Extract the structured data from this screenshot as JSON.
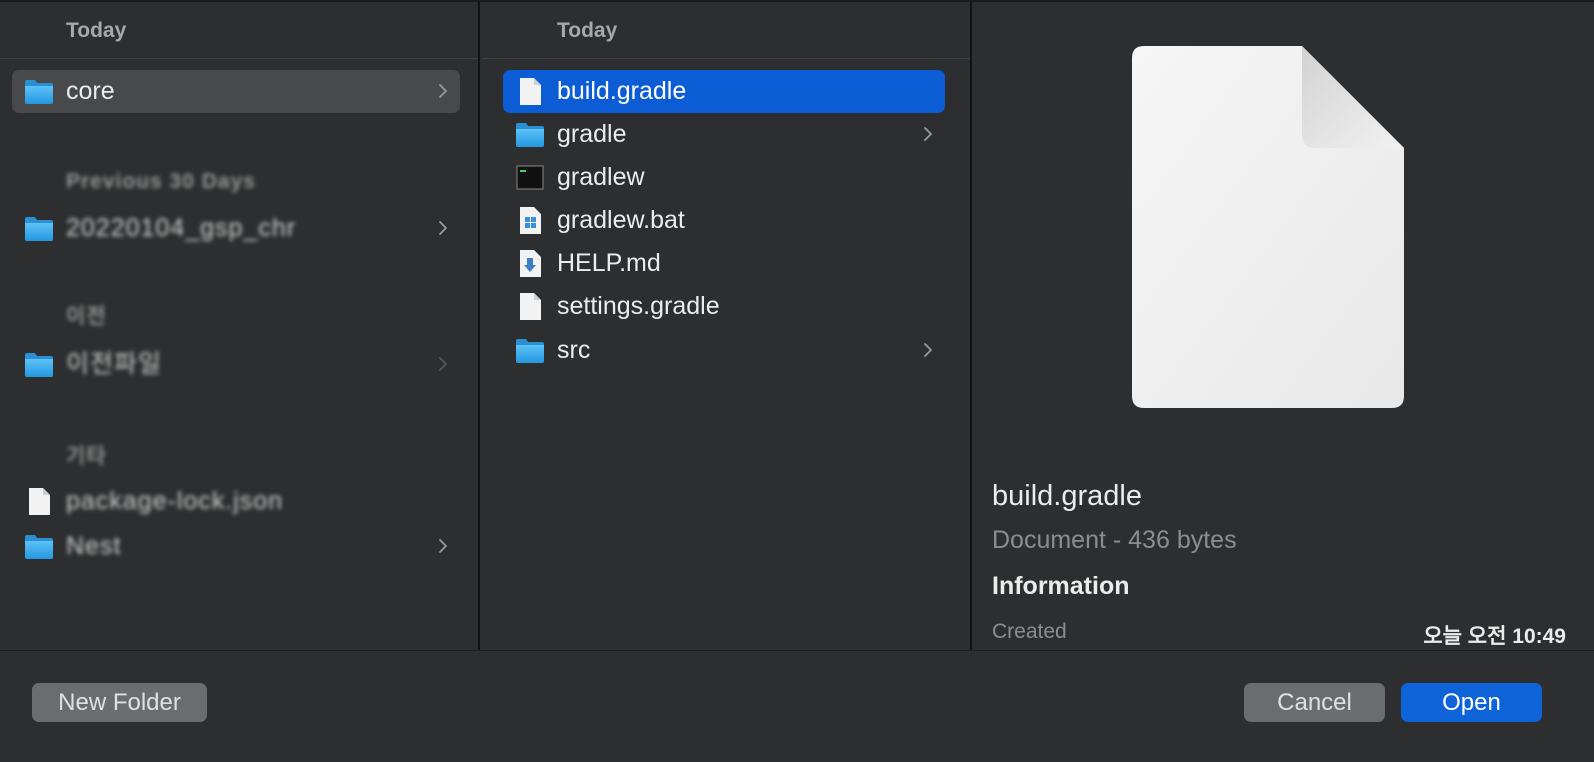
{
  "columns": {
    "left": {
      "sections": [
        {
          "header": "Today",
          "items": [
            {
              "label": "core",
              "icon": "folder-icon",
              "has_children": true,
              "selected": true
            }
          ]
        },
        {
          "header": "Previous 30 Days",
          "items": [
            {
              "label": "20220104_gsp_chr",
              "icon": "folder-icon",
              "has_children": true
            }
          ]
        },
        {
          "header": "이전",
          "items": [
            {
              "label": "이전파일",
              "icon": "folder-icon",
              "has_children": true
            }
          ]
        },
        {
          "header": "기타",
          "items": [
            {
              "label": "package-lock.json",
              "icon": "document-icon",
              "has_children": false
            },
            {
              "label": "Nest",
              "icon": "folder-icon",
              "has_children": true
            }
          ]
        }
      ]
    },
    "middle": {
      "header": "Today",
      "items": [
        {
          "label": "build.gradle",
          "icon": "document-icon",
          "selected": true
        },
        {
          "label": "gradle",
          "icon": "folder-icon",
          "has_children": true
        },
        {
          "label": "gradlew",
          "icon": "terminal-icon"
        },
        {
          "label": "gradlew.bat",
          "icon": "windows-document-icon"
        },
        {
          "label": "HELP.md",
          "icon": "markdown-document-icon"
        },
        {
          "label": "settings.gradle",
          "icon": "document-icon"
        },
        {
          "label": "src",
          "icon": "folder-icon",
          "has_children": true
        }
      ]
    },
    "preview": {
      "name": "build.gradle",
      "kind": "Document - 436 bytes",
      "info_header": "Information",
      "created_label": "Created",
      "created_value": "오늘 오전 10:49"
    }
  },
  "footer": {
    "new_folder": "New Folder",
    "cancel": "Cancel",
    "open": "Open"
  },
  "colors": {
    "selection_blue": "#0b5cd5",
    "selection_grey": "#48494b",
    "primary_button": "#0f63d9",
    "folder_blue": "#35a8e8"
  }
}
